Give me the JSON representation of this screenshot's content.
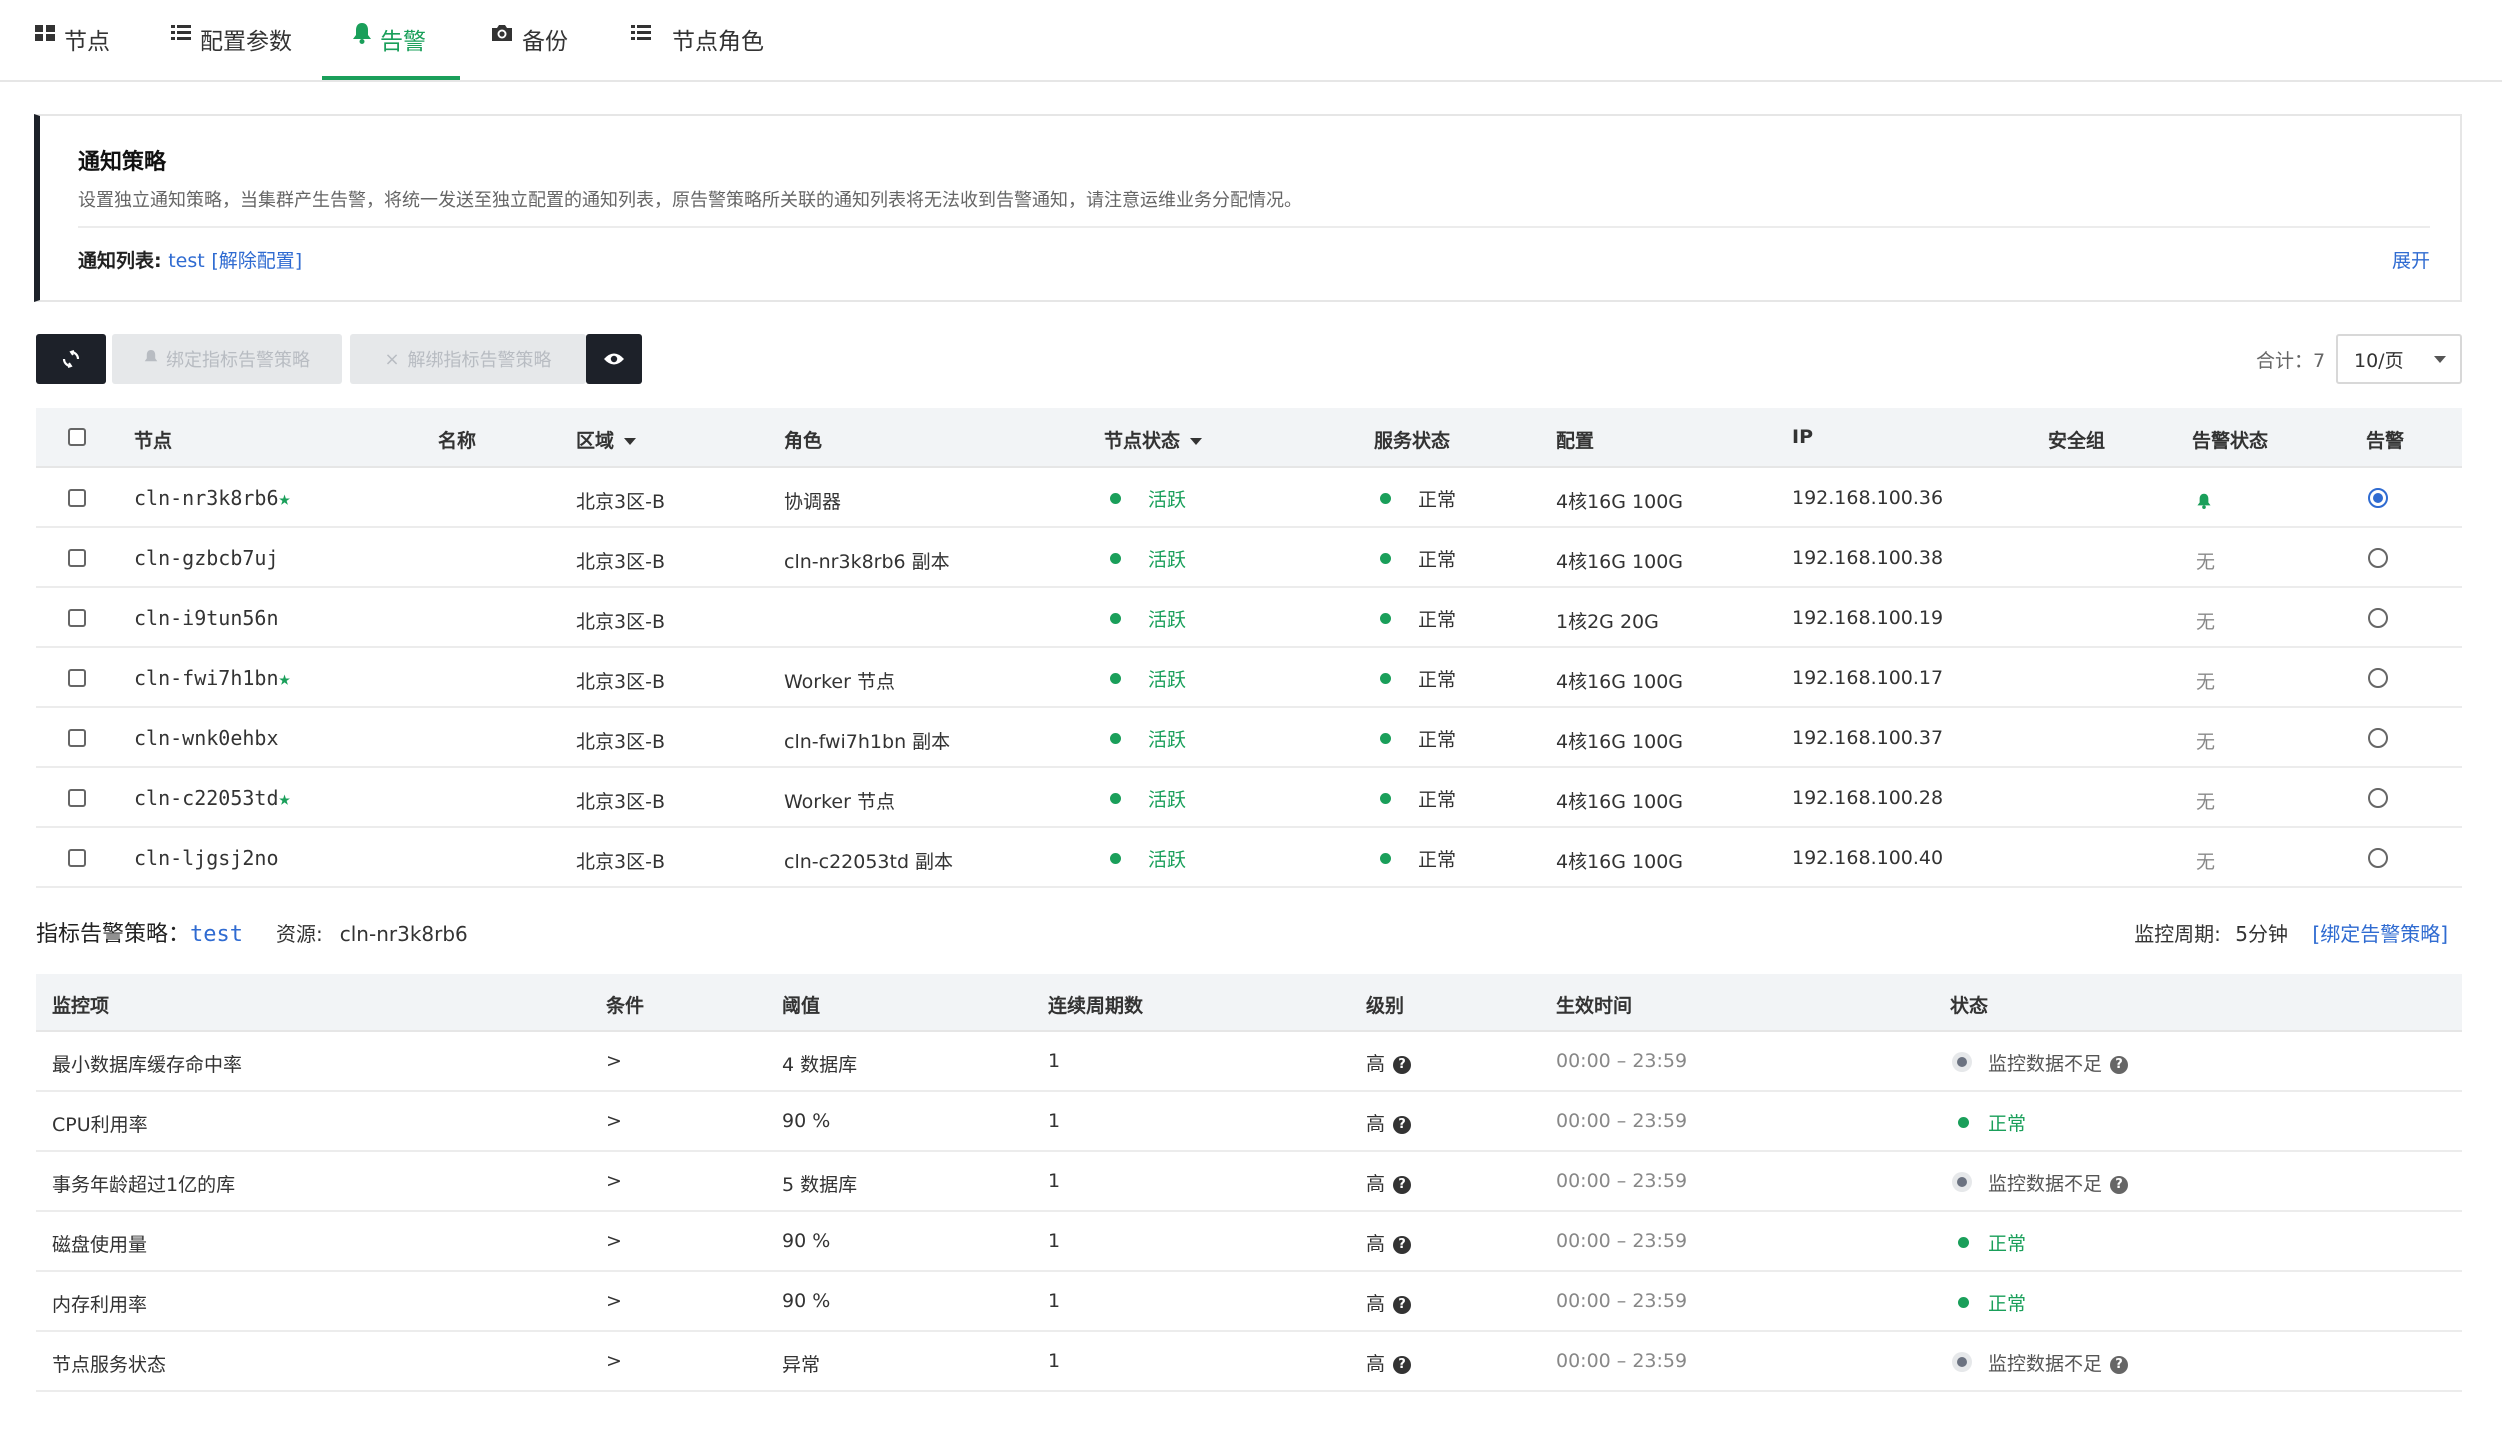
{
  "tabs": [
    {
      "label": "节点",
      "icon": "grid-icon"
    },
    {
      "label": "配置参数",
      "icon": "list-icon"
    },
    {
      "label": "告警",
      "icon": "bell-icon",
      "active": true
    },
    {
      "label": "备份",
      "icon": "camera-icon"
    },
    {
      "label": "节点角色",
      "icon": "list-icon"
    }
  ],
  "notice": {
    "title": "通知策略",
    "description": "设置独立通知策略，当集群产生告警，将统一发送至独立配置的通知列表，原告警策略所关联的通知列表将无法收到告警通知，请注意运维业务分配情况。",
    "list_label": "通知列表:",
    "list_value": "test",
    "unbind_label": "[解除配置]",
    "expand_label": "展开"
  },
  "toolbar": {
    "bind_label": "绑定指标告警策略",
    "unbind_label": "解绑指标告警策略",
    "total_label": "合计：7",
    "page_size": "10/页"
  },
  "node_table": {
    "headers": {
      "node": "节点",
      "name": "名称",
      "region": "区域",
      "role": "角色",
      "node_status": "节点状态",
      "service_status": "服务状态",
      "config": "配置",
      "ip": "IP",
      "security_group": "安全组",
      "alarm_status": "告警状态",
      "alarm": "告警"
    },
    "rows": [
      {
        "node": "cln-nr3k8rb6",
        "star": true,
        "region": "北京3区-B",
        "role": "协调器",
        "node_status": "活跃",
        "service_status": "正常",
        "config": "4核16G 100G",
        "ip": "192.168.100.36",
        "alarm_status": "",
        "alarm_icon": true,
        "selected": true
      },
      {
        "node": "cln-gzbcb7uj",
        "star": false,
        "region": "北京3区-B",
        "role": "cln-nr3k8rb6 副本",
        "node_status": "活跃",
        "service_status": "正常",
        "config": "4核16G 100G",
        "ip": "192.168.100.38",
        "alarm_status": "无",
        "selected": false
      },
      {
        "node": "cln-i9tun56n",
        "star": false,
        "region": "北京3区-B",
        "role": "",
        "node_status": "活跃",
        "service_status": "正常",
        "config": "1核2G 20G",
        "ip": "192.168.100.19",
        "alarm_status": "无",
        "selected": false
      },
      {
        "node": "cln-fwi7h1bn",
        "star": true,
        "region": "北京3区-B",
        "role": "Worker 节点",
        "node_status": "活跃",
        "service_status": "正常",
        "config": "4核16G 100G",
        "ip": "192.168.100.17",
        "alarm_status": "无",
        "selected": false
      },
      {
        "node": "cln-wnk0ehbx",
        "star": false,
        "region": "北京3区-B",
        "role": "cln-fwi7h1bn 副本",
        "node_status": "活跃",
        "service_status": "正常",
        "config": "4核16G 100G",
        "ip": "192.168.100.37",
        "alarm_status": "无",
        "selected": false
      },
      {
        "node": "cln-c22053td",
        "star": true,
        "region": "北京3区-B",
        "role": "Worker 节点",
        "node_status": "活跃",
        "service_status": "正常",
        "config": "4核16G 100G",
        "ip": "192.168.100.28",
        "alarm_status": "无",
        "selected": false
      },
      {
        "node": "cln-ljgsj2no",
        "star": false,
        "region": "北京3区-B",
        "role": "cln-c22053td 副本",
        "node_status": "活跃",
        "service_status": "正常",
        "config": "4核16G 100G",
        "ip": "192.168.100.40",
        "alarm_status": "无",
        "selected": false
      }
    ]
  },
  "policy": {
    "label": "指标告警策略：",
    "value": "test",
    "resource_label": "资源:",
    "resource_value": "cln-nr3k8rb6",
    "period_label": "监控周期:",
    "period_value": "5分钟",
    "bind_link": "[绑定告警策略]"
  },
  "policy_table": {
    "headers": {
      "item": "监控项",
      "condition": "条件",
      "threshold": "阈值",
      "cycles": "连续周期数",
      "level": "级别",
      "time": "生效时间",
      "status": "状态"
    },
    "rows": [
      {
        "item": "最小数据库缓存命中率",
        "condition": ">",
        "threshold": "4 数据库",
        "cycles": "1",
        "level": "高",
        "time": "00:00 – 23:59",
        "status": "监控数据不足",
        "ok": false
      },
      {
        "item": "CPU利用率",
        "condition": ">",
        "threshold": "90 %",
        "cycles": "1",
        "level": "高",
        "time": "00:00 – 23:59",
        "status": "正常",
        "ok": true
      },
      {
        "item": "事务年龄超过1亿的库",
        "condition": ">",
        "threshold": "5 数据库",
        "cycles": "1",
        "level": "高",
        "time": "00:00 – 23:59",
        "status": "监控数据不足",
        "ok": false
      },
      {
        "item": "磁盘使用量",
        "condition": ">",
        "threshold": "90 %",
        "cycles": "1",
        "level": "高",
        "time": "00:00 – 23:59",
        "status": "正常",
        "ok": true
      },
      {
        "item": "内存利用率",
        "condition": ">",
        "threshold": "90 %",
        "cycles": "1",
        "level": "高",
        "time": "00:00 – 23:59",
        "status": "正常",
        "ok": true
      },
      {
        "item": "节点服务状态",
        "condition": ">",
        "threshold": "异常",
        "cycles": "1",
        "level": "高",
        "time": "00:00 – 23:59",
        "status": "监控数据不足",
        "ok": false
      }
    ]
  },
  "colors": {
    "accent": "#1a9f5a",
    "link": "#2f6bd1",
    "dark": "#1d2129"
  }
}
